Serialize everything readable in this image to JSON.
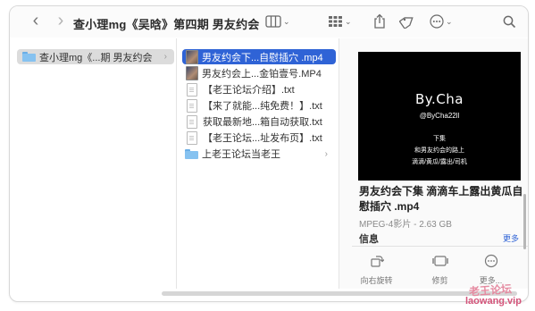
{
  "window": {
    "title": "查小理mg《吴晗》第四期 男友约会"
  },
  "toolbar": {
    "icons": [
      "chevron-left-icon",
      "chevron-right-icon",
      "column-view-icon",
      "grid-view-icon",
      "share-icon",
      "tag-icon",
      "more-icon",
      "search-icon"
    ]
  },
  "sidebar": {
    "items": [
      {
        "label": "查小理mg《...期 男友约会",
        "type": "folder",
        "selected": true
      }
    ]
  },
  "files": {
    "items": [
      {
        "label": "男友约会下...自慰插穴 .mp4",
        "type": "video",
        "selected": true
      },
      {
        "label": "男友约会上...金铂壹号.MP4",
        "type": "video",
        "selected": false
      },
      {
        "label": "【老王论坛介绍】.txt",
        "type": "text",
        "selected": false
      },
      {
        "label": "【来了就能...纯免费！】.txt",
        "type": "text",
        "selected": false
      },
      {
        "label": "获取最新地...箱自动获取.txt",
        "type": "text",
        "selected": false
      },
      {
        "label": "【老王论坛...址发布页】.txt",
        "type": "text",
        "selected": false
      },
      {
        "label": "上老王论坛当老王",
        "type": "folder",
        "selected": false
      }
    ]
  },
  "preview": {
    "image_brand": "By.Cha",
    "image_handle": "@ByCha22ll",
    "image_lines": [
      "下集",
      "和男友约会的路上",
      "滴滴/黄瓜/露出/司机"
    ],
    "title": "男友约会下集 滴滴车上露出黄瓜自慰插穴 .mp4",
    "meta": "MPEG-4影片 - 2.63 GB",
    "info_heading": "信息",
    "more_link": "更多",
    "actions": [
      {
        "label": "向右旋转",
        "icon": "rotate-right-icon"
      },
      {
        "label": "修剪",
        "icon": "trim-icon"
      },
      {
        "label": "更多...",
        "icon": "more-circle-icon"
      }
    ]
  },
  "watermark": {
    "site": "老王论坛",
    "domain": "laowang.vip"
  }
}
